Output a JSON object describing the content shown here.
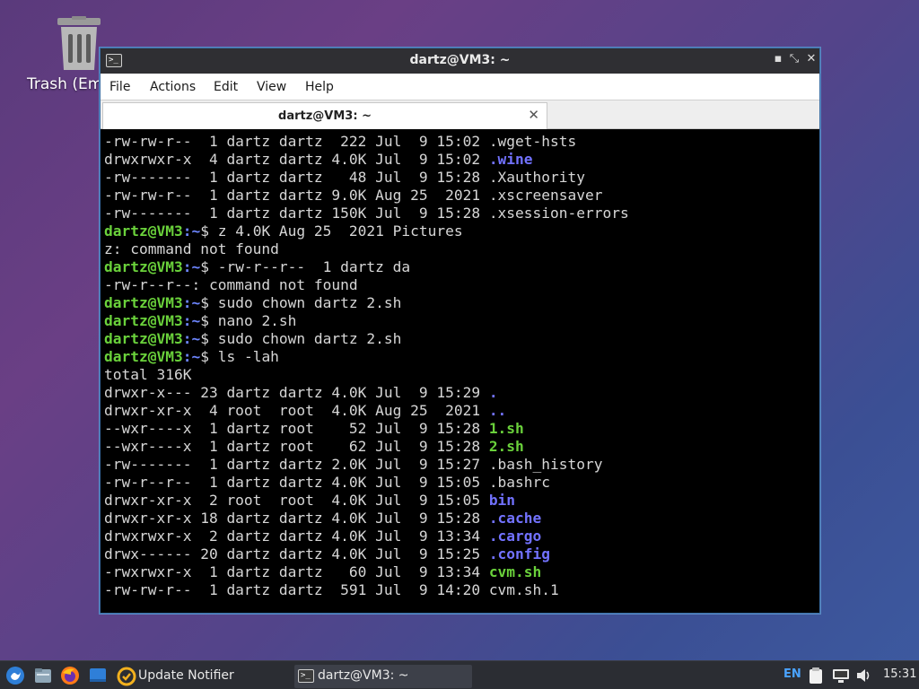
{
  "desktop": {
    "trash_label": "Trash (Em"
  },
  "window": {
    "title": "dartz@VM3: ~",
    "controls": {
      "minimize": "▪",
      "maximize": "⤡",
      "close": "✕"
    },
    "menu": [
      "File",
      "Actions",
      "Edit",
      "View",
      "Help"
    ],
    "tab": {
      "label": "dartz@VM3: ~",
      "close": "✕"
    }
  },
  "terminal": {
    "prompt_user": "dartz@VM3",
    "prompt_path": ":~",
    "lines": [
      {
        "t": "plain",
        "text": "-rw-rw-r--  1 dartz dartz  222 Jul  9 15:02 ",
        "name": ".wget-hsts",
        "cls": ""
      },
      {
        "t": "plain",
        "text": "drwxrwxr-x  4 dartz dartz 4.0K Jul  9 15:02 ",
        "name": ".wine",
        "cls": "c-blue"
      },
      {
        "t": "plain",
        "text": "-rw-------  1 dartz dartz   48 Jul  9 15:28 ",
        "name": ".Xauthority",
        "cls": ""
      },
      {
        "t": "plain",
        "text": "-rw-rw-r--  1 dartz dartz 9.0K Aug 25  2021 ",
        "name": ".xscreensaver",
        "cls": ""
      },
      {
        "t": "plain",
        "text": "-rw-------  1 dartz dartz 150K Jul  9 15:28 ",
        "name": ".xsession-errors",
        "cls": ""
      },
      {
        "t": "prompt",
        "text": "$ z 4.0K Aug 25  2021 Pictures"
      },
      {
        "t": "plain",
        "text": "z: command not found",
        "name": "",
        "cls": ""
      },
      {
        "t": "prompt",
        "text": "$ -rw-r--r--  1 dartz da"
      },
      {
        "t": "plain",
        "text": "-rw-r--r--: command not found",
        "name": "",
        "cls": ""
      },
      {
        "t": "prompt",
        "text": "$ sudo chown dartz 2.sh"
      },
      {
        "t": "prompt",
        "text": "$ nano 2.sh"
      },
      {
        "t": "prompt",
        "text": "$ sudo chown dartz 2.sh"
      },
      {
        "t": "prompt",
        "text": "$ ls -lah"
      },
      {
        "t": "plain",
        "text": "total 316K",
        "name": "",
        "cls": ""
      },
      {
        "t": "plain",
        "text": "drwxr-x--- 23 dartz dartz 4.0K Jul  9 15:29 ",
        "name": ".",
        "cls": "c-blue"
      },
      {
        "t": "plain",
        "text": "drwxr-xr-x  4 root  root  4.0K Aug 25  2021 ",
        "name": "..",
        "cls": "c-blue"
      },
      {
        "t": "plain",
        "text": "--wxr----x  1 dartz root    52 Jul  9 15:28 ",
        "name": "1.sh",
        "cls": "c-green"
      },
      {
        "t": "plain",
        "text": "--wxr----x  1 dartz root    62 Jul  9 15:28 ",
        "name": "2.sh",
        "cls": "c-green"
      },
      {
        "t": "plain",
        "text": "-rw-------  1 dartz dartz 2.0K Jul  9 15:27 ",
        "name": ".bash_history",
        "cls": ""
      },
      {
        "t": "plain",
        "text": "-rw-r--r--  1 dartz dartz 4.0K Jul  9 15:05 ",
        "name": ".bashrc",
        "cls": ""
      },
      {
        "t": "plain",
        "text": "drwxr-xr-x  2 root  root  4.0K Jul  9 15:05 ",
        "name": "bin",
        "cls": "c-blue"
      },
      {
        "t": "plain",
        "text": "drwxr-xr-x 18 dartz dartz 4.0K Jul  9 15:28 ",
        "name": ".cache",
        "cls": "c-blue"
      },
      {
        "t": "plain",
        "text": "drwxrwxr-x  2 dartz dartz 4.0K Jul  9 13:34 ",
        "name": ".cargo",
        "cls": "c-blue"
      },
      {
        "t": "plain",
        "text": "drwx------ 20 dartz dartz 4.0K Jul  9 15:25 ",
        "name": ".config",
        "cls": "c-blue"
      },
      {
        "t": "plain",
        "text": "-rwxrwxr-x  1 dartz dartz   60 Jul  9 13:34 ",
        "name": "cvm.sh",
        "cls": "c-green"
      },
      {
        "t": "plain",
        "text": "-rw-rw-r--  1 dartz dartz  591 Jul  9 14:20 ",
        "name": "cvm.sh.1",
        "cls": ""
      }
    ]
  },
  "taskbar": {
    "update_notifier": "Update Notifier",
    "terminal_task": "dartz@VM3: ~",
    "keyboard_layout": "EN",
    "clock": "15:31"
  },
  "icons": {
    "start_menu": "start-menu-icon",
    "file_manager": "file-manager-icon",
    "firefox": "firefox-icon",
    "show_desktop": "show-desktop-icon",
    "update_notifier": "update-notifier-icon",
    "terminal": "terminal-icon",
    "clipboard": "clipboard-icon",
    "network": "network-icon",
    "volume": "volume-icon"
  }
}
